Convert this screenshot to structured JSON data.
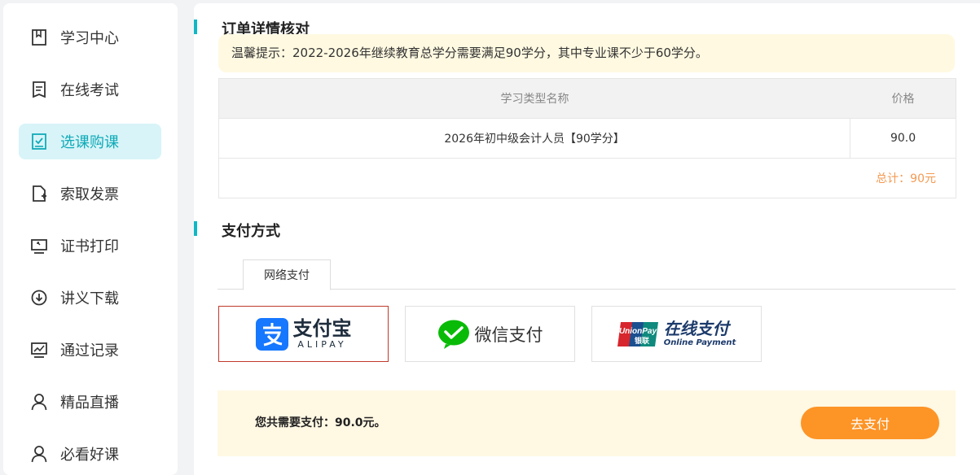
{
  "sidebar": {
    "items": [
      {
        "label": "学习中心",
        "icon": "book-icon",
        "active": false
      },
      {
        "label": "在线考试",
        "icon": "exam-paper-icon",
        "active": false
      },
      {
        "label": "选课购课",
        "icon": "checkbox-icon",
        "active": true
      },
      {
        "label": "索取发票",
        "icon": "invoice-add-icon",
        "active": false
      },
      {
        "label": "证书打印",
        "icon": "certificate-icon",
        "active": false
      },
      {
        "label": "讲义下载",
        "icon": "download-icon",
        "active": false
      },
      {
        "label": "通过记录",
        "icon": "chart-record-icon",
        "active": false
      },
      {
        "label": "精品直播",
        "icon": "user-icon",
        "active": false
      },
      {
        "label": "必看好课",
        "icon": "user-icon",
        "active": false
      }
    ]
  },
  "order": {
    "section_title": "订单详情核对",
    "tip": "温馨提示：2022-2026年继续教育总学分需要满足90学分，其中专业课不少于60学分。",
    "table": {
      "headers": [
        "学习类型名称",
        "价格"
      ],
      "rows": [
        {
          "name": "2026年初中级会计人员【90学分】",
          "price": "90.0"
        }
      ],
      "total": "总计：90元"
    }
  },
  "payment": {
    "section_title": "支付方式",
    "tab_label": "网络支付",
    "methods": [
      {
        "name": "alipay",
        "label": "支付宝",
        "sublabel": "ALIPAY",
        "selected": true
      },
      {
        "name": "wechat",
        "label": "微信支付",
        "selected": false
      },
      {
        "name": "unionpay",
        "label": "在线支付",
        "sublabel": "Online Payment",
        "brand_text": "UnionPay",
        "brand_sub": "银联",
        "selected": false
      }
    ],
    "amount_text": "您共需要支付：90.0元。",
    "pay_button": "去支付"
  },
  "colors": {
    "accent": "#10b8c4",
    "active_bg": "#d8f4f8",
    "button": "#fd9426",
    "total": "#f39a52",
    "alipay_blue": "#1677ff",
    "wechat_green": "#09bb07"
  }
}
